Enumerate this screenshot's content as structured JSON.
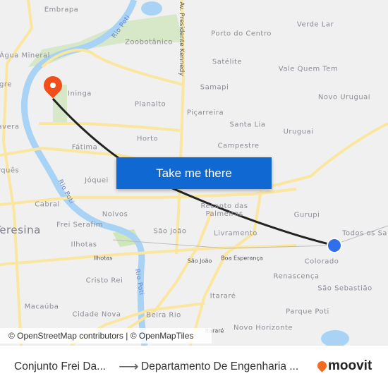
{
  "map": {
    "labels": {
      "embrapa": "Embrapa",
      "rio_poti_north": "Rio Poti",
      "av_kennedy": "Av. Presidente Kennedy",
      "porto_do_centro": "Porto do Centro",
      "verde_lar": "Verde Lar",
      "zoobotanico": "Zoobotânico",
      "agua_mineral": "Água Mineral",
      "satelite": "Satélite",
      "vale_quem_tem": "Vale Quem Tem",
      "samapi": "Samapi",
      "novo_uruguai": "Novo Uruguai",
      "alegre": "gre",
      "ininga": "Ininga",
      "planalto": "Planalto",
      "picarreira": "Piçarreira",
      "santa_lia": "Santa Lia",
      "uruguai": "Uruguai",
      "primavera": "avera",
      "horto": "Horto",
      "campestre": "Campestre",
      "fatima": "Fátima",
      "marques": "rquês",
      "joquei": "Jóquei",
      "rio_poti_west": "Rio Poti",
      "cabral": "Cabral",
      "noivos": "Noivos",
      "recanto": "Recanto das Palmeiras",
      "gurupi": "Gurupi",
      "teresina": "Teresina",
      "frei_serafim": "Frei Serafim",
      "sao_joao": "São João",
      "livramento": "Livramento",
      "todos_os_santos": "Todos os Sa",
      "ilhotas": "Ilhotas",
      "ilhotas_road": "Ilhotas",
      "sao_joao_road": "São João",
      "boa_esperanca": "Boa Esperança",
      "colorado": "Colorado",
      "rio_poti_south": "Rio Poti",
      "renascenca": "Renascença",
      "cristo_rei": "Cristo Rei",
      "sao_sebastiao": "São Sebastião",
      "itarare": "Itararé",
      "parque_poti": "Parque Poti",
      "macauba": "Macaúba",
      "cidade_nova": "Cidade Nova",
      "beira_rio": "Beira Rio",
      "novo_horizonte": "Novo Horizonte",
      "itarare_road": "Itararé"
    },
    "colors": {
      "route": "#222222",
      "destination_pin": "#f04e1a",
      "origin_dot": "#2f6fe8",
      "button": "#1069d3",
      "road": "#fbe6a0",
      "river": "#a8d3f5",
      "park": "#d6e8c8"
    },
    "attribution": "© OpenStreetMap contributors | © OpenMapTiles"
  },
  "cta": {
    "label": "Take me there"
  },
  "footer": {
    "origin": "Conjunto Frei Da...",
    "arrow": "⟶",
    "destination": "Departamento De Engenharia ...",
    "brand": "moovit"
  }
}
